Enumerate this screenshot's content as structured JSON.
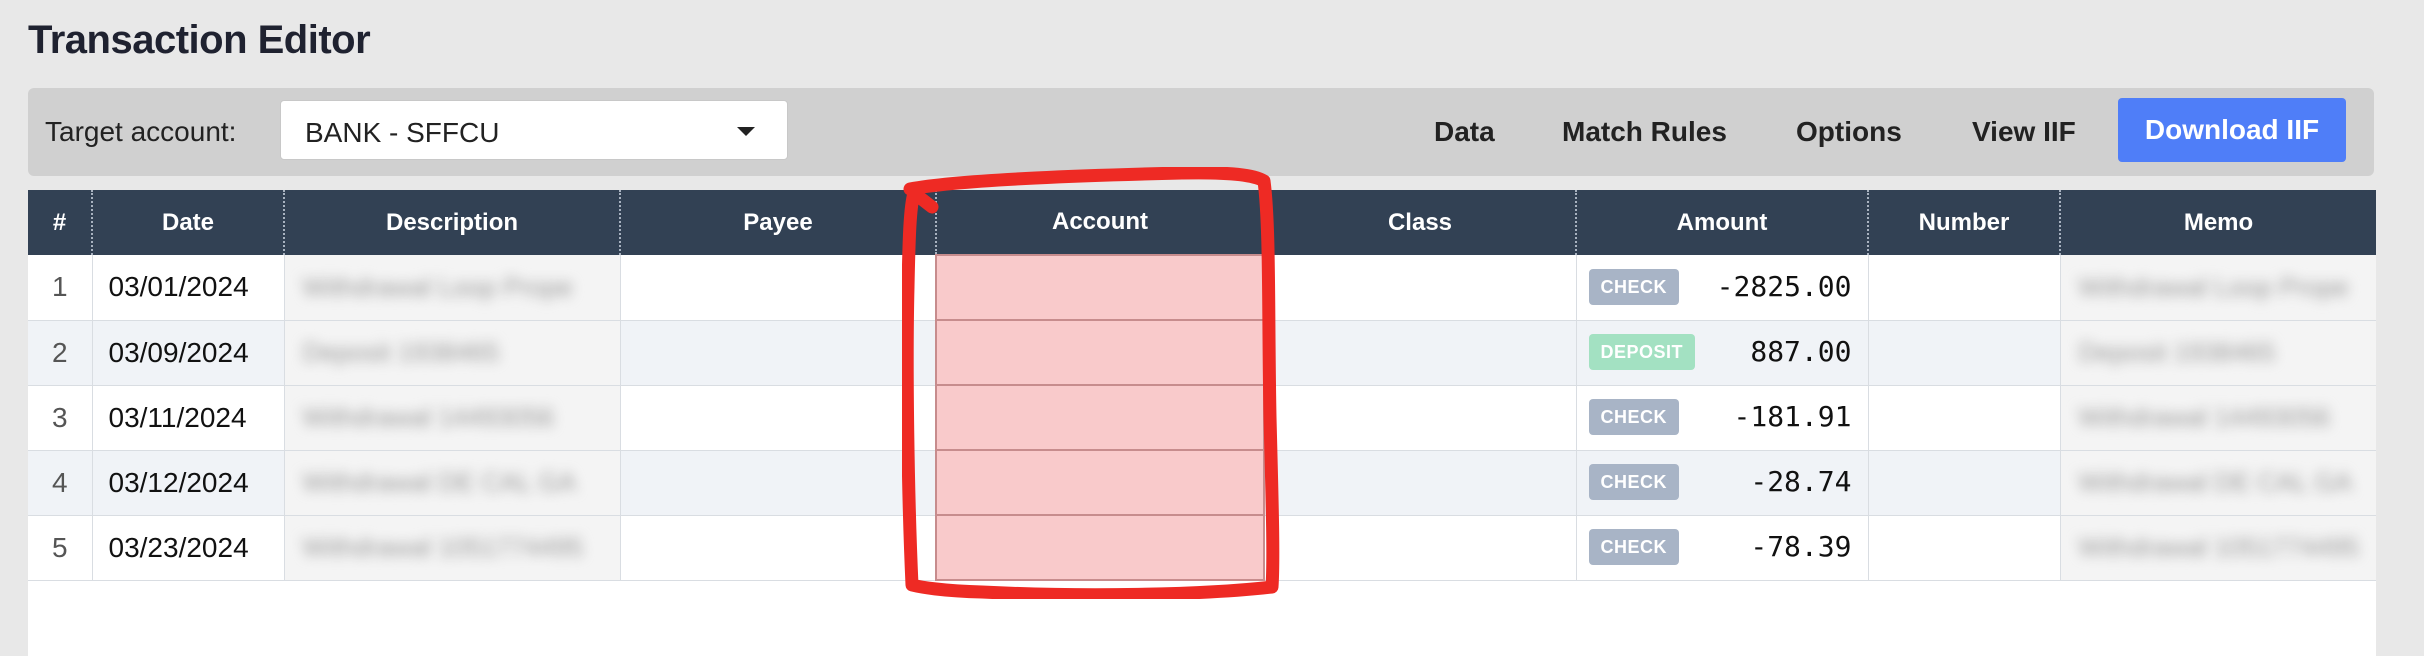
{
  "app": {
    "title": "Transaction Editor"
  },
  "toolbar": {
    "target_label": "Target account:",
    "target_value": "BANK - SFFCU",
    "menu": [
      "Data",
      "Match Rules",
      "Options",
      "View IIF"
    ],
    "download_label": "Download IIF",
    "accent": "#4f7ef8"
  },
  "table": {
    "headers": [
      "#",
      "Date",
      "Description",
      "Payee",
      "Account",
      "Class",
      "Amount",
      "Number",
      "Memo"
    ],
    "rows": [
      {
        "index": "1",
        "date": "03/01/2024",
        "description": "Withdrawal Loop Prope",
        "payee": "",
        "account": "",
        "class": "",
        "type": "CHECK",
        "amount": "-2825.00",
        "number": "",
        "memo": "Withdrawal Loop Prope"
      },
      {
        "index": "2",
        "date": "03/09/2024",
        "description": "Deposit 1938465",
        "payee": "",
        "account": "",
        "class": "",
        "type": "DEPOSIT",
        "amount": "887.00",
        "number": "",
        "memo": "Deposit 1938465"
      },
      {
        "index": "3",
        "date": "03/11/2024",
        "description": "Withdrawal 14493056",
        "payee": "",
        "account": "",
        "class": "",
        "type": "CHECK",
        "amount": "-181.91",
        "number": "",
        "memo": "Withdrawal 14493056"
      },
      {
        "index": "4",
        "date": "03/12/2024",
        "description": "Withdrawal DE CAL GA",
        "payee": "",
        "account": "",
        "class": "",
        "type": "CHECK",
        "amount": "-28.74",
        "number": "",
        "memo": "Withdrawal DE CAL GA"
      },
      {
        "index": "5",
        "date": "03/23/2024",
        "description": "Withdrawal 1051774495",
        "payee": "",
        "account": "",
        "class": "",
        "type": "CHECK",
        "amount": "-78.39",
        "number": "",
        "memo": "Withdrawal 1051774495"
      }
    ]
  },
  "annotation": {
    "color": "#ee2a24"
  }
}
